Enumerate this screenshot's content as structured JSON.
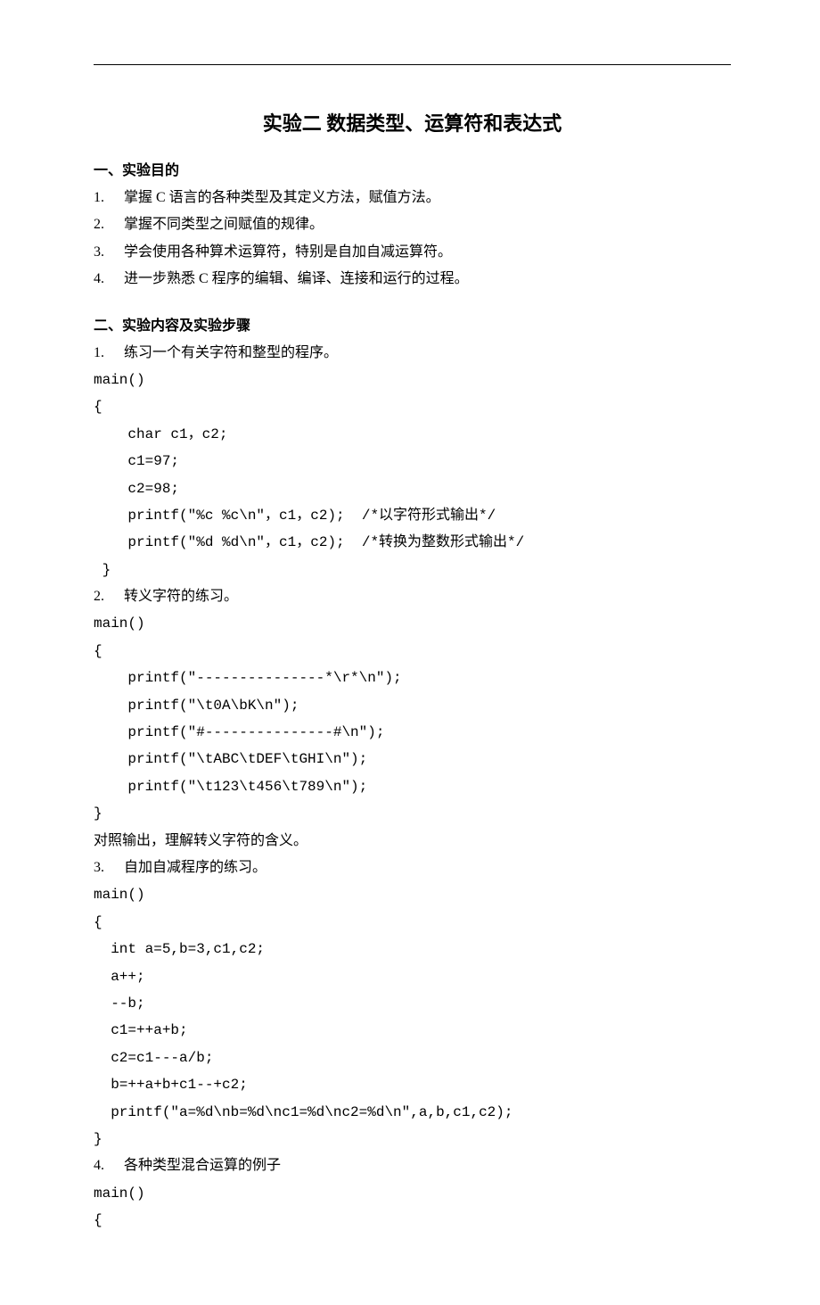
{
  "title": "实验二 数据类型、运算符和表达式",
  "section_a": {
    "heading": "一、实验目的",
    "items": [
      {
        "num": "1.",
        "text": "掌握 C 语言的各种类型及其定义方法，赋值方法。"
      },
      {
        "num": "2.",
        "text": "掌握不同类型之间赋值的规律。"
      },
      {
        "num": "3.",
        "text": "学会使用各种算术运算符，特别是自加自减运算符。"
      },
      {
        "num": "4.",
        "text": "进一步熟悉 C 程序的编辑、编译、连接和运行的过程。"
      }
    ]
  },
  "section_b": {
    "heading": "二、实验内容及实验步骤",
    "ex1": {
      "num": "1.",
      "desc": "练习一个有关字符和整型的程序。",
      "code": "main()\n{\n    char c1，c2;\n    c1=97;\n    c2=98;\n    printf(\"%c %c\\n\"，c1，c2);  /*以字符形式输出*/\n    printf(\"%d %d\\n\"，c1，c2);  /*转换为整数形式输出*/\n }"
    },
    "ex2": {
      "num": "2.",
      "desc": "转义字符的练习。",
      "code": "main()\n{\n    printf(\"---------------*\\r*\\n\");\n    printf(\"\\t0A\\bK\\n\");\n    printf(\"#---------------#\\n\");\n    printf(\"\\tABC\\tDEF\\tGHI\\n\");\n    printf(\"\\t123\\t456\\t789\\n\");\n}",
      "trailer": "对照输出，理解转义字符的含义。"
    },
    "ex3": {
      "num": "3.",
      "desc": "自加自减程序的练习。",
      "code": "main()\n{\n  int a=5,b=3,c1,c2;\n  a++;\n  --b;\n  c1=++a+b;\n  c2=c1---a/b;\n  b=++a+b+c1--+c2;\n  printf(\"a=%d\\nb=%d\\nc1=%d\\nc2=%d\\n\",a,b,c1,c2);\n}"
    },
    "ex4": {
      "num": "4.",
      "desc": "各种类型混合运算的例子",
      "code": "main()\n{"
    }
  }
}
